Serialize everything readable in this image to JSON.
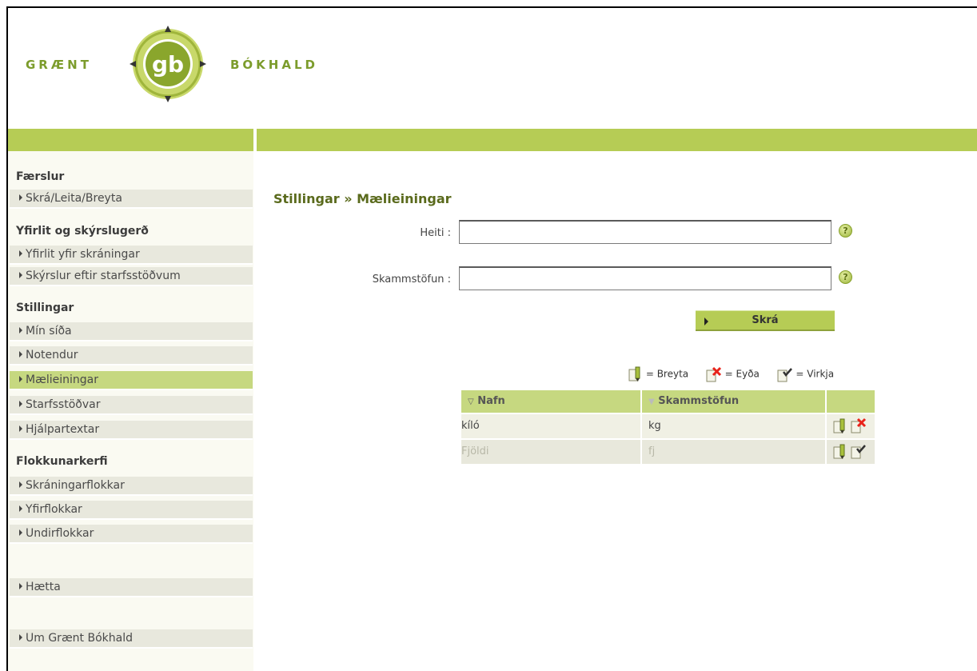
{
  "brand": {
    "left_text": "GRÆNT",
    "right_text": "BÓKHALD",
    "mark_text": "gb"
  },
  "sidebar": {
    "sections": [
      {
        "title": "Færslur",
        "items": [
          {
            "label": "Skrá/Leita/Breyta"
          }
        ]
      },
      {
        "title": "Yfirlit og skýrslugerð",
        "items": [
          {
            "label": "Yfirlit yfir skráningar"
          },
          {
            "label": "Skýrslur eftir starfsstöðvum"
          }
        ]
      },
      {
        "title": "Stillingar",
        "items": [
          {
            "label": "Mín síða"
          },
          {
            "label": "Notendur"
          },
          {
            "label": "Mælieiningar",
            "active": true
          },
          {
            "label": "Starfsstöðvar"
          },
          {
            "label": "Hjálpartextar"
          }
        ]
      },
      {
        "title": "Flokkunarkerfi",
        "items": [
          {
            "label": "Skráningarflokkar"
          },
          {
            "label": "Yfirflokkar"
          },
          {
            "label": "Undirflokkar"
          }
        ]
      }
    ],
    "logout": "Hætta",
    "about": "Um Grænt Bókhald"
  },
  "main": {
    "breadcrumb": "Stillingar » Mælieiningar",
    "form": {
      "name_label": "Heiti :",
      "name_value": "",
      "abbr_label": "Skammstöfun :",
      "abbr_value": "",
      "help_glyph": "?",
      "submit_label": "Skrá"
    },
    "legend": {
      "edit": "= Breyta",
      "delete": "= Eyða",
      "activate": "= Virkja"
    },
    "table": {
      "columns": [
        "Nafn",
        "Skammstöfun"
      ],
      "rows": [
        {
          "name": "kíló",
          "abbr": "kg",
          "active": true
        },
        {
          "name": "Fjöldi",
          "abbr": "fj",
          "active": false
        }
      ]
    }
  },
  "colors": {
    "accent": "#b6cc55",
    "active_row": "#c6d880",
    "title": "#5a6a1c",
    "delete": "#e8231a"
  }
}
